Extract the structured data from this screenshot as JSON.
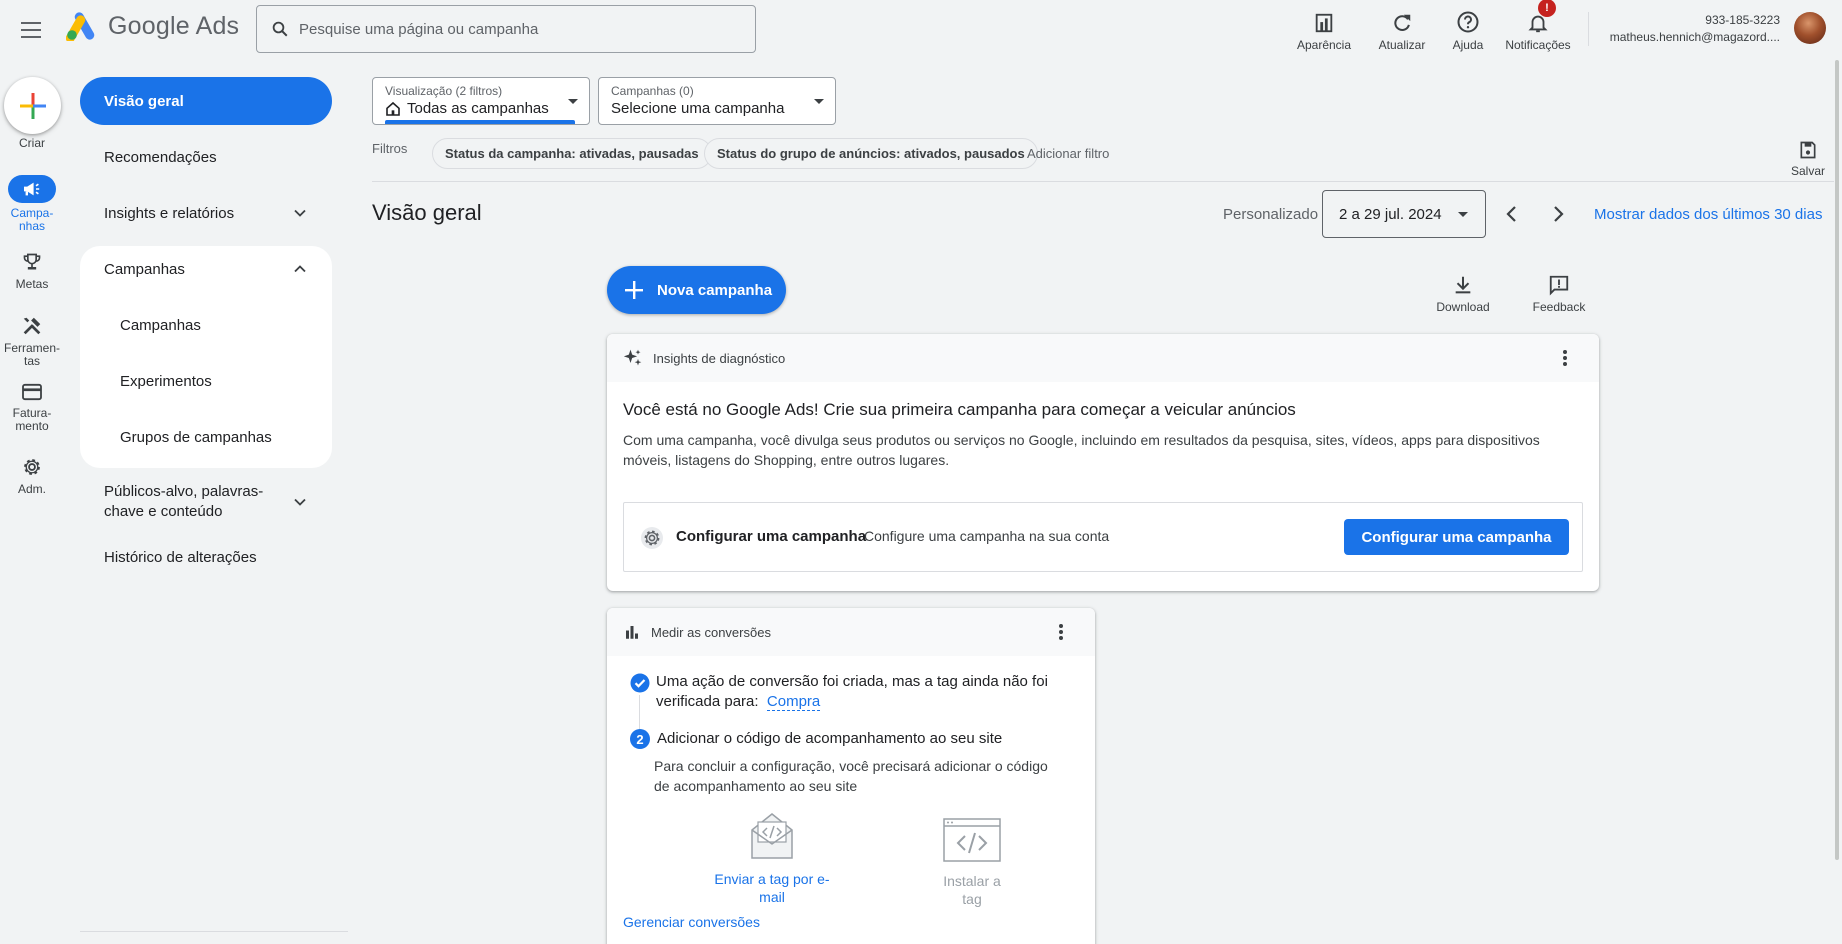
{
  "header": {
    "logo_text": "Google Ads",
    "search_placeholder": "Pesquise uma página ou campanha",
    "actions": {
      "appearance": "Aparência",
      "refresh": "Atualizar",
      "help": "Ajuda",
      "notifications": "Notificações",
      "notifications_badge": "!"
    },
    "account": {
      "phone": "933-185-3223",
      "email": "matheus.hennich@magazord...."
    }
  },
  "rail": {
    "create": "Criar",
    "campaigns": "Campa-\nnhas",
    "goals": "Metas",
    "tools": "Ferramen-\ntas",
    "billing": "Fatura-\nmento",
    "admin": "Adm."
  },
  "sidenav": {
    "overview": "Visão geral",
    "recommendations": "Recomendações",
    "insights": "Insights e relatórios",
    "campaigns_group": "Campanhas",
    "campaigns": "Campanhas",
    "experiments": "Experimentos",
    "campaign_groups": "Grupos de campanhas",
    "audiences": "Públicos-alvo, palavras-chave e conteúdo",
    "change_history": "Histórico de alterações"
  },
  "filters": {
    "view_label": "Visualização (2 filtros)",
    "view_value": "Todas as campanhas",
    "campaign_label": "Campanhas (0)",
    "campaign_value": "Selecione uma campanha",
    "filters_label": "Filtros",
    "chip_campaign_status": "Status da campanha: ativadas, pausadas",
    "chip_adgroup_status": "Status do grupo de anúncios: ativados, pausados",
    "add_filter": "Adicionar filtro",
    "save": "Salvar"
  },
  "page": {
    "title": "Visão geral",
    "date_mode": "Personalizado",
    "date_range": "2 a 29 jul. 2024",
    "last_30_link": "Mostrar dados dos últimos 30 dias",
    "new_campaign": "Nova campanha",
    "download": "Download",
    "feedback": "Feedback"
  },
  "insights_card": {
    "header": "Insights de diagnóstico",
    "title": "Você está no Google Ads! Crie sua primeira campanha para começar a veicular anúncios",
    "body": "Com uma campanha, você divulga seus produtos ou serviços no Google, incluindo em resultados da pesquisa, sites, vídeos, apps para dispositivos móveis, listagens do Shopping, entre outros lugares.",
    "setup_title": "Configurar uma campanha",
    "setup_desc": "Configure uma campanha na sua conta",
    "setup_button": "Configurar uma campanha"
  },
  "conversions_card": {
    "header": "Medir as conversões",
    "step1_text": "Uma ação de conversão foi criada, mas a tag ainda não foi verificada para:",
    "step1_link": "Compra",
    "step2_number": "2",
    "step2_title": "Adicionar o código de acompanhamento ao seu site",
    "step2_desc": "Para concluir a configuração, você precisará adicionar o código de acompanhamento ao seu site",
    "email_tag": "Enviar a tag por e-mail",
    "install_tag": "Instalar a tag",
    "manage": "Gerenciar conversões"
  },
  "colors": {
    "accent": "#1a73e8",
    "background": "#f1f3f4",
    "badge": "#c5221f"
  }
}
